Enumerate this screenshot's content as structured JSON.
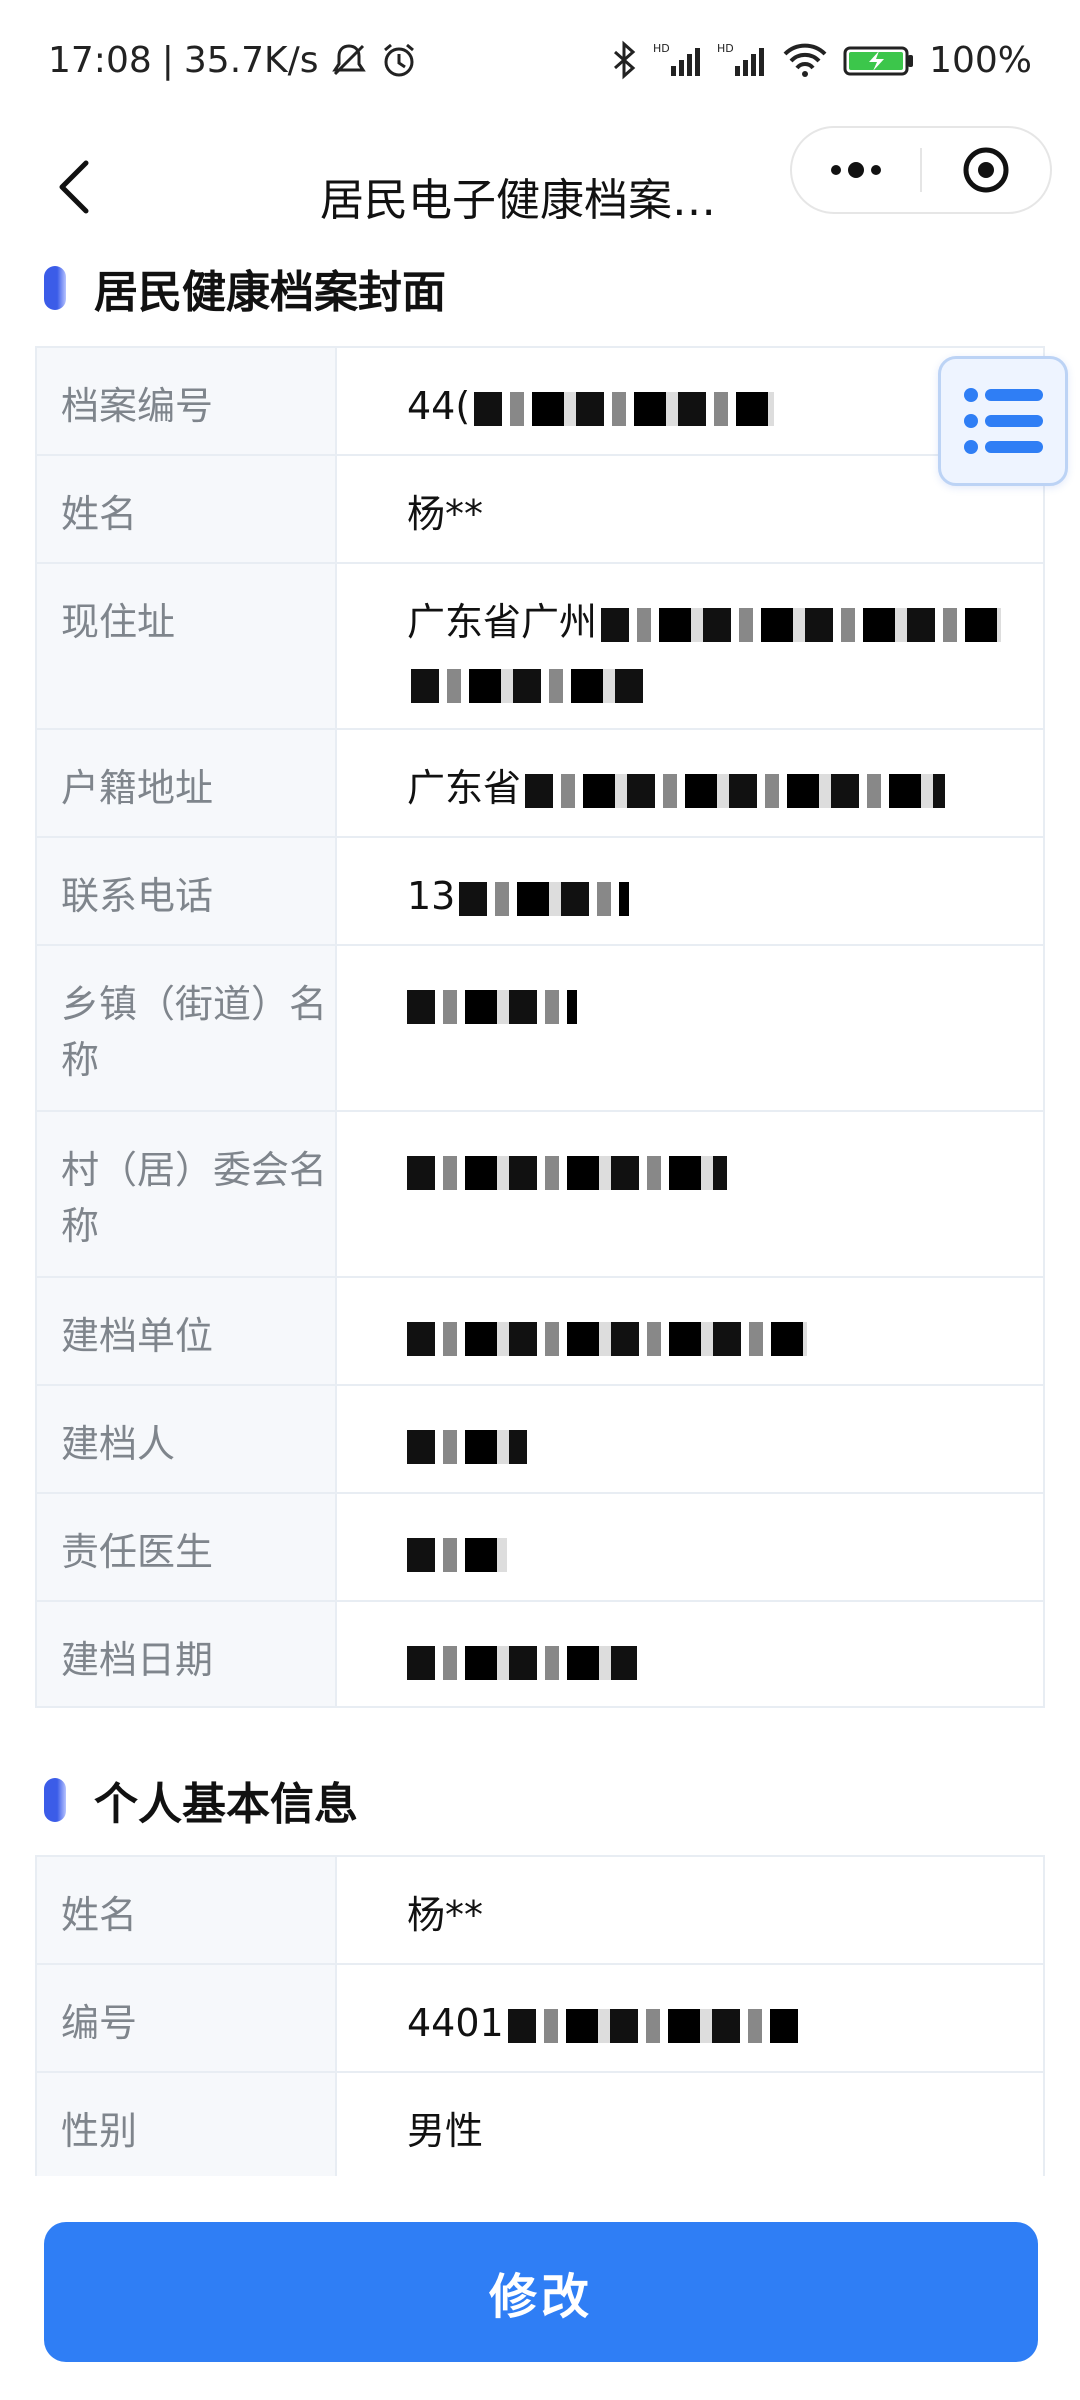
{
  "status_bar": {
    "time": "17:08",
    "network_speed": "35.7K/s",
    "battery": "100%",
    "icons": [
      "mute-icon",
      "alarm-icon",
      "bluetooth-icon",
      "signal-hd-icon",
      "signal-hd-icon",
      "wifi-icon",
      "battery-charging-icon"
    ]
  },
  "nav": {
    "title": "居民电子健康档案…"
  },
  "sections": {
    "cover_title": "居民健康档案封面",
    "basic_title": "个人基本信息"
  },
  "cover_rows": [
    {
      "label": "档案编号",
      "value": "44("
    },
    {
      "label": "姓名",
      "value": "杨**"
    },
    {
      "label": "现住址",
      "value": "广东省广州"
    },
    {
      "label": "户籍地址",
      "value": "广东省"
    },
    {
      "label": "联系电话",
      "value": "13"
    },
    {
      "label": "乡镇（街道）名称",
      "value": ""
    },
    {
      "label": "村（居）委会名称",
      "value": ""
    },
    {
      "label": "建档单位",
      "value": ""
    },
    {
      "label": "建档人",
      "value": ""
    },
    {
      "label": "责任医生",
      "value": ""
    },
    {
      "label": "建档日期",
      "value": ""
    }
  ],
  "basic_rows": [
    {
      "label": "姓名",
      "value": "杨**"
    },
    {
      "label": "编号",
      "value": "4401"
    },
    {
      "label": "性别",
      "value": "男性"
    }
  ],
  "actions": {
    "edit_label": "修改"
  },
  "colors": {
    "accent": "#2f7ef5",
    "section_bar": "#3b5ce8",
    "label_bg": "#f6f8fb",
    "border": "#e8edf3"
  }
}
